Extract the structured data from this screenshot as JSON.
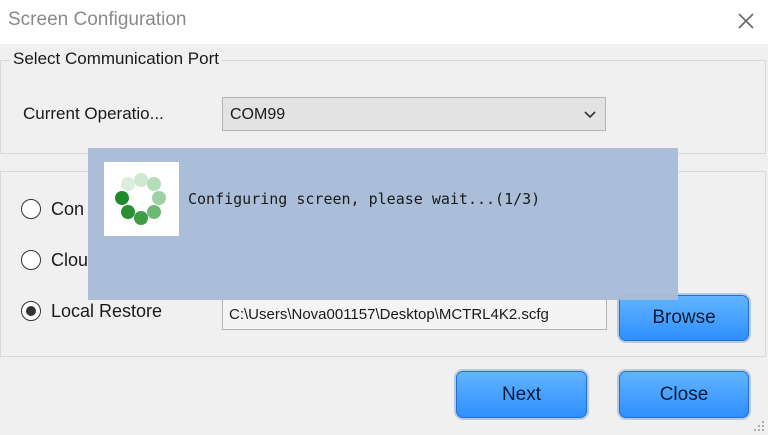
{
  "window": {
    "title": "Screen Configuration"
  },
  "port_group": {
    "legend": "Select Communication Port",
    "current_operation_label": "Current Operatio...",
    "selected_port": "COM99"
  },
  "options": {
    "radio1_label": "Con",
    "radio2_label": "Clou",
    "radio3_label": "Local Restore",
    "selected": "Local Restore",
    "file_path": "C:\\Users\\Nova001157\\Desktop\\MCTRL4K2.scfg",
    "browse_label": "Browse"
  },
  "buttons": {
    "next_label": "Next",
    "close_label": "Close"
  },
  "progress": {
    "message": "Configuring screen, please wait...(1/3)"
  },
  "colors": {
    "button_blue": "#2f8fff",
    "overlay_bg": "#a8bcd8",
    "spinner_green": "#1e8a2a"
  },
  "icons": {
    "close": "close-icon",
    "dropdown": "chevron-down-icon",
    "spinner": "loading-spinner-icon",
    "grip": "resize-grip-icon"
  }
}
